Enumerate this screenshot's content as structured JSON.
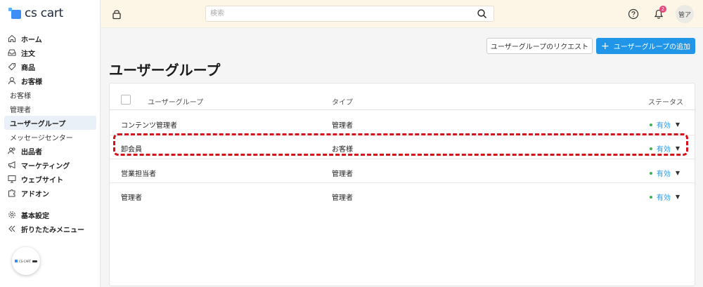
{
  "app": {
    "logo_text": "cs cart",
    "mini_logo_text": "CS-CART"
  },
  "sidebar": {
    "items": [
      {
        "label": "ホーム",
        "icon": "home-icon",
        "kind": "main"
      },
      {
        "label": "注文",
        "icon": "inbox-icon",
        "kind": "main"
      },
      {
        "label": "商品",
        "icon": "tag-icon",
        "kind": "main"
      },
      {
        "label": "お客様",
        "icon": "user-icon",
        "kind": "main"
      },
      {
        "label": "お客様",
        "kind": "sub"
      },
      {
        "label": "管理者",
        "kind": "sub"
      },
      {
        "label": "ユーザーグループ",
        "kind": "sub-active"
      },
      {
        "label": "メッセージセンター",
        "kind": "sub"
      },
      {
        "label": "出品者",
        "icon": "users-icon",
        "kind": "main"
      },
      {
        "label": "マーケティング",
        "icon": "megaphone-icon",
        "kind": "main"
      },
      {
        "label": "ウェブサイト",
        "icon": "monitor-icon",
        "kind": "main"
      },
      {
        "label": "アドオン",
        "icon": "puzzle-icon",
        "kind": "main"
      }
    ],
    "bottom": [
      {
        "label": "基本設定",
        "icon": "gear-icon"
      },
      {
        "label": "折りたたみメニュー",
        "icon": "double-chevron-left-icon"
      }
    ]
  },
  "topbar": {
    "search_placeholder": "検索",
    "notification_count": "2",
    "user_initials": "管ア"
  },
  "toolbar": {
    "request_label": "ユーザーグループのリクエスト",
    "add_label": "ユーザーグループの追加"
  },
  "page": {
    "title": "ユーザーグループ"
  },
  "table": {
    "headers": {
      "name": "ユーザーグループ",
      "type": "タイプ",
      "status": "ステータス"
    },
    "rows": [
      {
        "name": "コンテンツ管理者",
        "type": "管理者",
        "status": "有効"
      },
      {
        "name": "卸会員",
        "type": "お客様",
        "status": "有効"
      },
      {
        "name": "営業担当者",
        "type": "管理者",
        "status": "有効"
      },
      {
        "name": "管理者",
        "type": "管理者",
        "status": "有効"
      }
    ]
  },
  "colors": {
    "accent": "#2196e8",
    "status_active": "#3eb356",
    "highlight": "#d4101b",
    "topbar_bg": "#fdf6e6"
  }
}
